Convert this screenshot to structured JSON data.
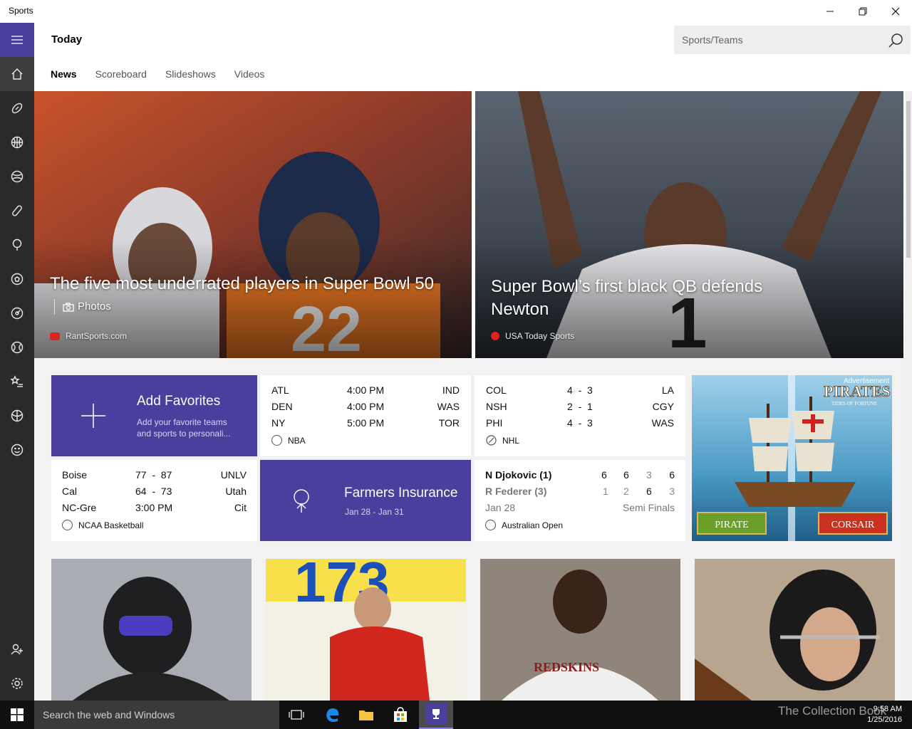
{
  "window": {
    "title": "Sports"
  },
  "header": {
    "title": "Today",
    "search_placeholder": "Sports/Teams"
  },
  "tabs": [
    {
      "label": "News"
    },
    {
      "label": "Scoreboard"
    },
    {
      "label": "Slideshows"
    },
    {
      "label": "Videos"
    }
  ],
  "heroes": [
    {
      "headline": "The five most underrated players in Super Bowl 50",
      "photos_label": "Photos",
      "source": "RantSports.com"
    },
    {
      "headline": "Super Bowl’s first black QB defends Newton",
      "source": "USA Today Sports"
    }
  ],
  "favorites": {
    "title": "Add Favorites",
    "subtitle": "Add your favorite teams and sports to personali..."
  },
  "nba": {
    "rows": [
      {
        "home": "ATL",
        "time": "4:00 PM",
        "away": "IND"
      },
      {
        "home": "DEN",
        "time": "4:00 PM",
        "away": "WAS"
      },
      {
        "home": "NY",
        "time": "5:00 PM",
        "away": "TOR"
      }
    ],
    "league": "NBA"
  },
  "nhl": {
    "rows": [
      {
        "home": "COL",
        "score": "4  -  3",
        "away": "LA"
      },
      {
        "home": "NSH",
        "score": "2  -  1",
        "away": "CGY"
      },
      {
        "home": "PHI",
        "score": "4  -  3",
        "away": "WAS"
      }
    ],
    "league": "NHL"
  },
  "ncaa": {
    "rows": [
      {
        "home": "Boise",
        "score": "77  -  87",
        "away": "UNLV"
      },
      {
        "home": "Cal",
        "score": "64  -  73",
        "away": "Utah"
      },
      {
        "home": "NC-Gre",
        "score": "3:00 PM",
        "away": "Cit"
      }
    ],
    "league": "NCAA Basketball"
  },
  "golf": {
    "title": "Farmers Insurance",
    "dates": "Jan 28 - Jan 31"
  },
  "tennis": {
    "p1": {
      "name": "N Djokovic (1)",
      "sets": [
        "6",
        "6",
        "3",
        "6"
      ]
    },
    "p2": {
      "name": "R Federer (3)",
      "sets": [
        "1",
        "2",
        "6",
        "3"
      ]
    },
    "date": "Jan 28",
    "round": "Semi Finals",
    "league": "Australian Open"
  },
  "ad": {
    "label": "Advertisement",
    "title": "PIRATES",
    "subtitle": "TIDES OF FORTUNE",
    "left_button": "PIRATE",
    "right_button": "CORSAIR"
  },
  "taskbar": {
    "search": "Search the web and Windows",
    "time": "9:58 AM",
    "date": "1/25/2016"
  },
  "watermark": "The Collection Book",
  "colors": {
    "accent": "#4b3f9e",
    "rail": "#2b2b2b",
    "taskbar": "#101010"
  }
}
